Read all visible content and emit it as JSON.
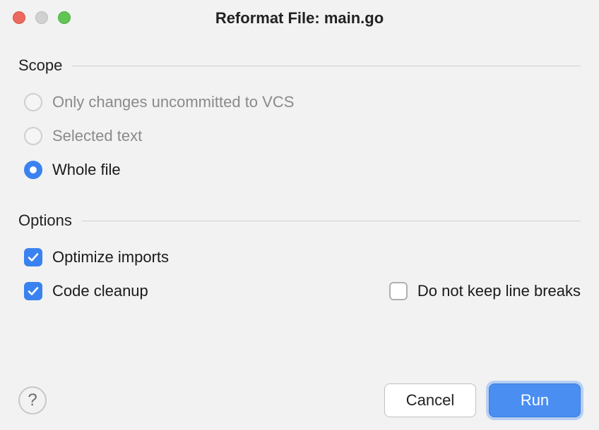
{
  "window": {
    "title": "Reformat File: main.go"
  },
  "sections": {
    "scope": {
      "label": "Scope",
      "options": {
        "vcs": "Only changes uncommitted to VCS",
        "selected_text": "Selected text",
        "whole_file": "Whole file"
      }
    },
    "options": {
      "label": "Options",
      "optimize_imports": "Optimize imports",
      "code_cleanup": "Code cleanup",
      "no_line_breaks": "Do not keep line breaks"
    }
  },
  "footer": {
    "help": "?",
    "cancel": "Cancel",
    "run": "Run"
  }
}
